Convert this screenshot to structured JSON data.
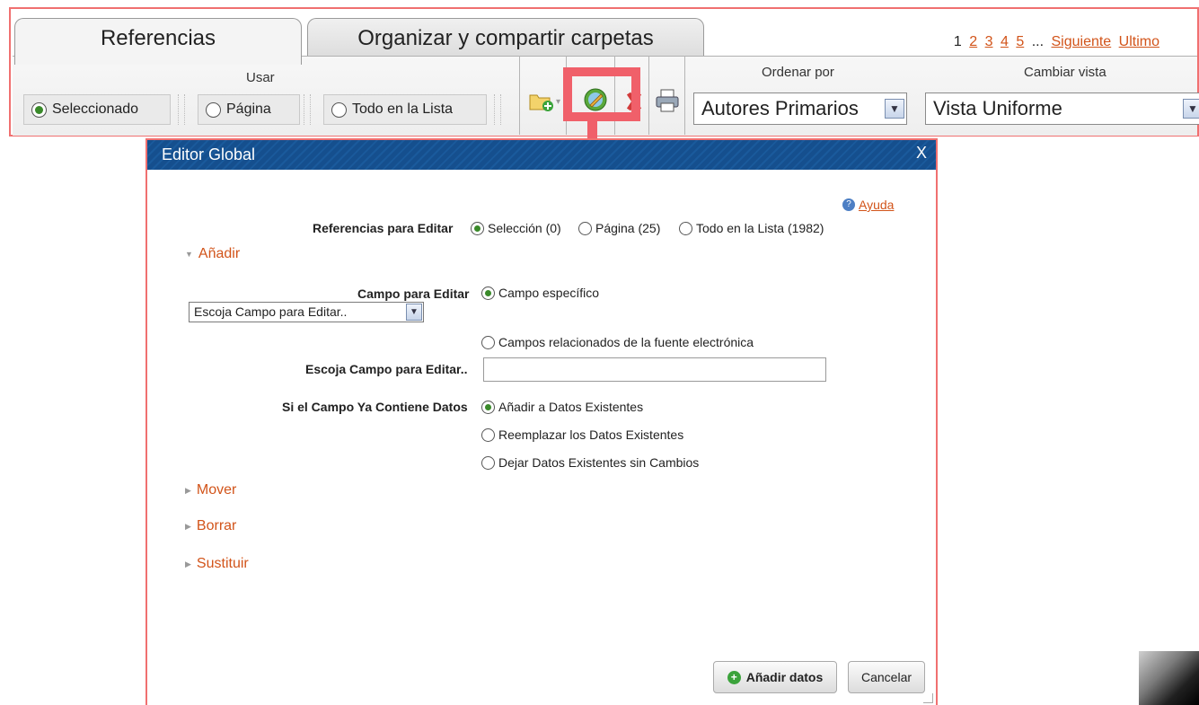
{
  "tabs": [
    {
      "label": "Referencias",
      "active": true
    },
    {
      "label": "Organizar y compartir carpetas",
      "active": false
    }
  ],
  "pager": {
    "current": "1",
    "pages": [
      "2",
      "3",
      "4",
      "5"
    ],
    "ellipsis": "...",
    "next": "Siguiente",
    "last": "Ultimo"
  },
  "usar": {
    "label": "Usar",
    "options": [
      {
        "label": "Seleccionado",
        "checked": true
      },
      {
        "label": "Página",
        "checked": false
      },
      {
        "label": "Todo en la Lista",
        "checked": false
      }
    ]
  },
  "toolbar_icons": [
    "add-to-folder-icon",
    "global-edit-icon",
    "delete-icon",
    "print-icon"
  ],
  "ordenar": {
    "label": "Ordenar por",
    "value": "Autores Primarios"
  },
  "vista": {
    "label": "Cambiar vista",
    "value": "Vista Uniforme"
  },
  "colors": {
    "accent": "#d2541a",
    "highlight": "#f0606a",
    "titlebar": "#154f8e"
  },
  "dialog": {
    "title": "Editor Global",
    "close": "X",
    "help": "Ayuda",
    "refs_label": "Referencias para Editar",
    "refs_options": [
      {
        "label": "Selección (0)",
        "checked": true
      },
      {
        "label": "Página (25)",
        "checked": false
      },
      {
        "label": "Todo en la Lista (1982)",
        "checked": false
      }
    ],
    "sections": {
      "add": "Añadir",
      "move": "Mover",
      "delete": "Borrar",
      "replace": "Sustituir"
    },
    "field_label": "Campo para Editar",
    "field_specific": "Campo específico",
    "field_select": "Escoja Campo para Editar..",
    "field_related": "Campos relacionados de la fuente electrónica",
    "choose_label": "Escoja Campo para Editar..",
    "choose_value": "",
    "existing_label": "Si el Campo Ya Contiene Datos",
    "existing_options": [
      {
        "label": "Añadir a Datos Existentes",
        "checked": true
      },
      {
        "label": "Reemplazar los Datos Existentes",
        "checked": false
      },
      {
        "label": "Dejar Datos Existentes sin Cambios",
        "checked": false
      }
    ],
    "add_button": "Añadir datos",
    "cancel_button": "Cancelar"
  }
}
